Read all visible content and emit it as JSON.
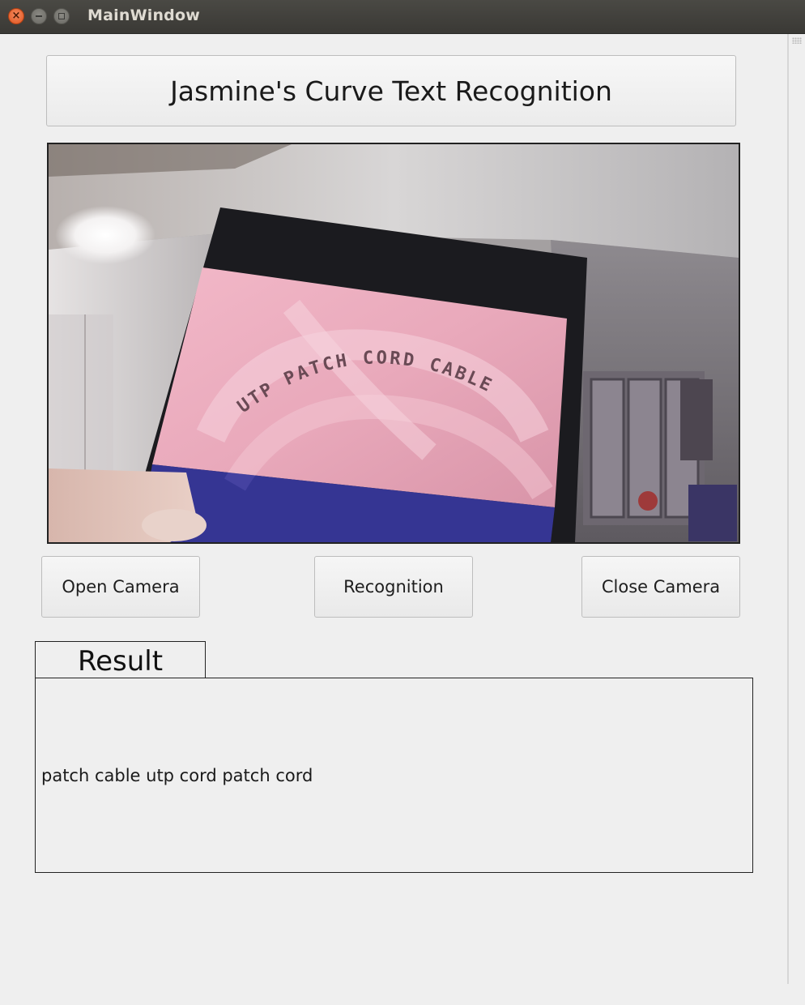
{
  "window": {
    "title": "MainWindow"
  },
  "header": {
    "title": "Jasmine's Curve Text Recognition"
  },
  "camera": {
    "frame_text": "UTP PATCH CORD CABLE"
  },
  "buttons": {
    "open_camera": "Open Camera",
    "recognition": "Recognition",
    "close_camera": "Close Camera"
  },
  "result": {
    "label": "Result",
    "text": "patch cable utp cord patch cord"
  },
  "icons": {
    "close": "close-icon",
    "minimize": "minimize-icon",
    "maximize": "maximize-icon"
  },
  "colors": {
    "titlebar": "#3c3b37",
    "close_button": "#e95420",
    "window_bg": "#efefef"
  }
}
